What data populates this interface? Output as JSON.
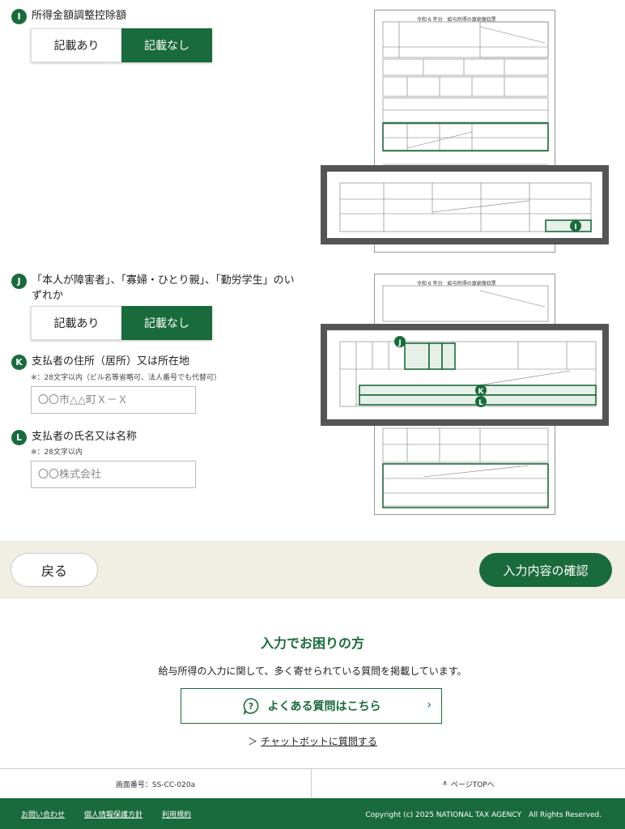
{
  "sections": {
    "I": {
      "badge": "I",
      "title": "所得金額調整控除額",
      "option_yes": "記載あり",
      "option_no": "記載なし",
      "selected": "記載なし"
    },
    "J": {
      "badge": "J",
      "title_line1": "「本人が障害者」、「寡婦・ひとり親」、「勤労学生」のい",
      "title_line2": "ずれか",
      "option_yes": "記載あり",
      "option_no": "記載なし",
      "selected": "記載なし"
    },
    "K": {
      "badge": "K",
      "title": "支払者の住所（居所）又は所在地",
      "note": "※：28文字以内（ビル名等省略可、法人番号でも代替可）",
      "placeholder": "〇〇市△△町Ｘ－Ｘ",
      "value": ""
    },
    "L": {
      "badge": "L",
      "title": "支払者の氏名又は名称",
      "note": "※：28文字以内",
      "placeholder": "〇〇株式会社",
      "value": ""
    }
  },
  "form_image": {
    "sheet_title": "令和 6 年分　給与所得の源泉徴収票",
    "zoom1_marker": "I",
    "zoom2_markers": [
      "J",
      "K",
      "L"
    ]
  },
  "actions": {
    "back_label": "戻る",
    "confirm_label": "入力内容の確認"
  },
  "help": {
    "title": "入力でお困りの方",
    "description": "給与所得の入力に関して、多く寄せられている質問を掲載しています。",
    "faq_label": "よくある質問はこちら",
    "chat_prefix": "＞",
    "chat_label": "チャットボットに質問する"
  },
  "info": {
    "screen_no": "画面番号：SS-CC-020a",
    "page_top": "ページTOPへ"
  },
  "footer": {
    "links": [
      "お問い合わせ",
      "個人情報保護方針",
      "利用規約"
    ],
    "copyright": "Copyright (c) 2025 NATIONAL TAX AGENCY　All Rights Reserved."
  },
  "colors": {
    "brand_green": "#1a6b3b",
    "action_bar_bg": "#f1eee4"
  }
}
